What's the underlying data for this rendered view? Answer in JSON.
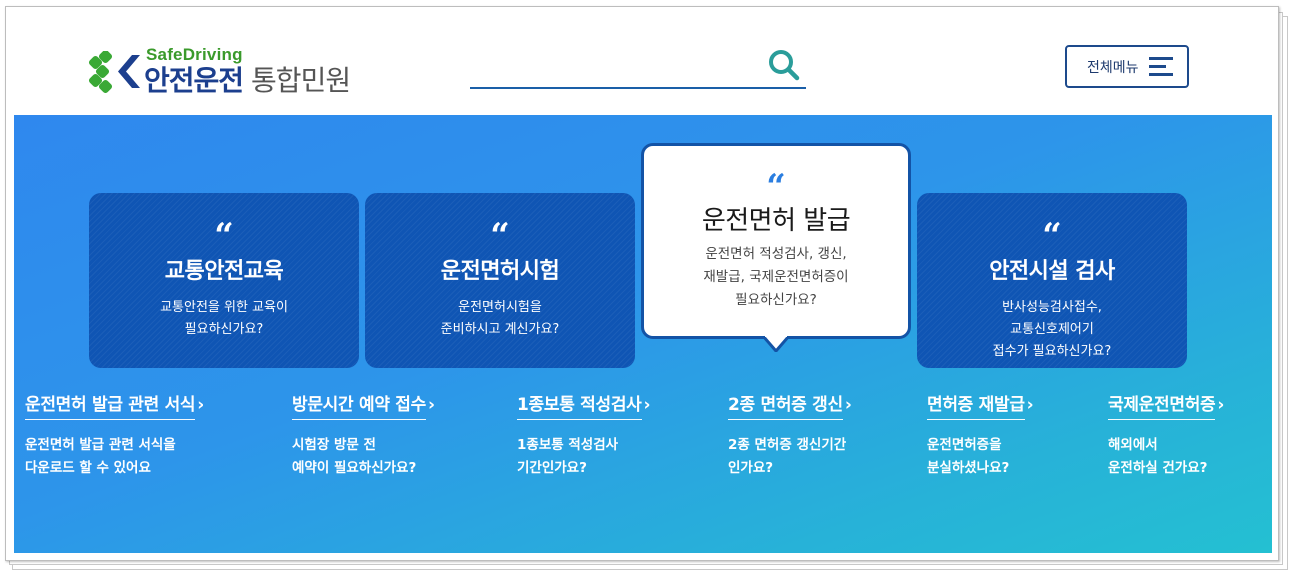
{
  "header": {
    "logo_sub": "SafeDriving",
    "logo_main_a": "안전운전",
    "logo_main_b": "통합민원",
    "search_placeholder": "",
    "menu_label": "전체메뉴"
  },
  "cards": [
    {
      "quote": "“",
      "title": "교통안전교육",
      "desc": [
        "교통안전을 위한 교육이",
        "필요하신가요?"
      ]
    },
    {
      "quote": "“",
      "title": "운전면허시험",
      "desc": [
        "운전면허시험을",
        "준비하시고 계신가요?"
      ]
    },
    {
      "quote": "“",
      "title": "운전면허 발급",
      "desc": [
        "운전면허 적성검사, 갱신,",
        "재발급, 국제운전면허증이",
        "필요하신가요?"
      ],
      "active": true
    },
    {
      "quote": "“",
      "title": "안전시설 검사",
      "desc": [
        "반사성능검사접수,",
        "교통신호제어기",
        "접수가 필요하신가요?"
      ]
    }
  ],
  "links": [
    {
      "title": "운전면허 발급 관련 서식",
      "desc": [
        "운전면허 발급 관련 서식을",
        "다운로드 할 수 있어요"
      ]
    },
    {
      "title": "방문시간 예약 접수",
      "desc": [
        "시험장 방문 전",
        "예약이 필요하신가요?"
      ]
    },
    {
      "title": "1종보통 적성검사",
      "desc": [
        "1종보통 적성검사",
        "기간인가요?"
      ]
    },
    {
      "title": "2종 면허증 갱신",
      "desc": [
        "2종 면허증 갱신기간",
        "인가요?"
      ]
    },
    {
      "title": "면허증 재발급",
      "desc": [
        "운전면허증을",
        "분실하셨나요?"
      ]
    },
    {
      "title": "국제운전면허증",
      "desc": [
        "해외에서",
        "운전하실 건가요?"
      ]
    }
  ],
  "chevron": "›",
  "colors": {
    "brand_blue": "#1c3f8e",
    "brand_green": "#3a9a2b",
    "hero_start": "#2f88ee",
    "hero_end": "#24c0d2",
    "card_bg": "#0f55b4"
  },
  "icons": {
    "search": "search-icon",
    "menu": "hamburger-icon",
    "logo": "logo-mark-icon"
  }
}
